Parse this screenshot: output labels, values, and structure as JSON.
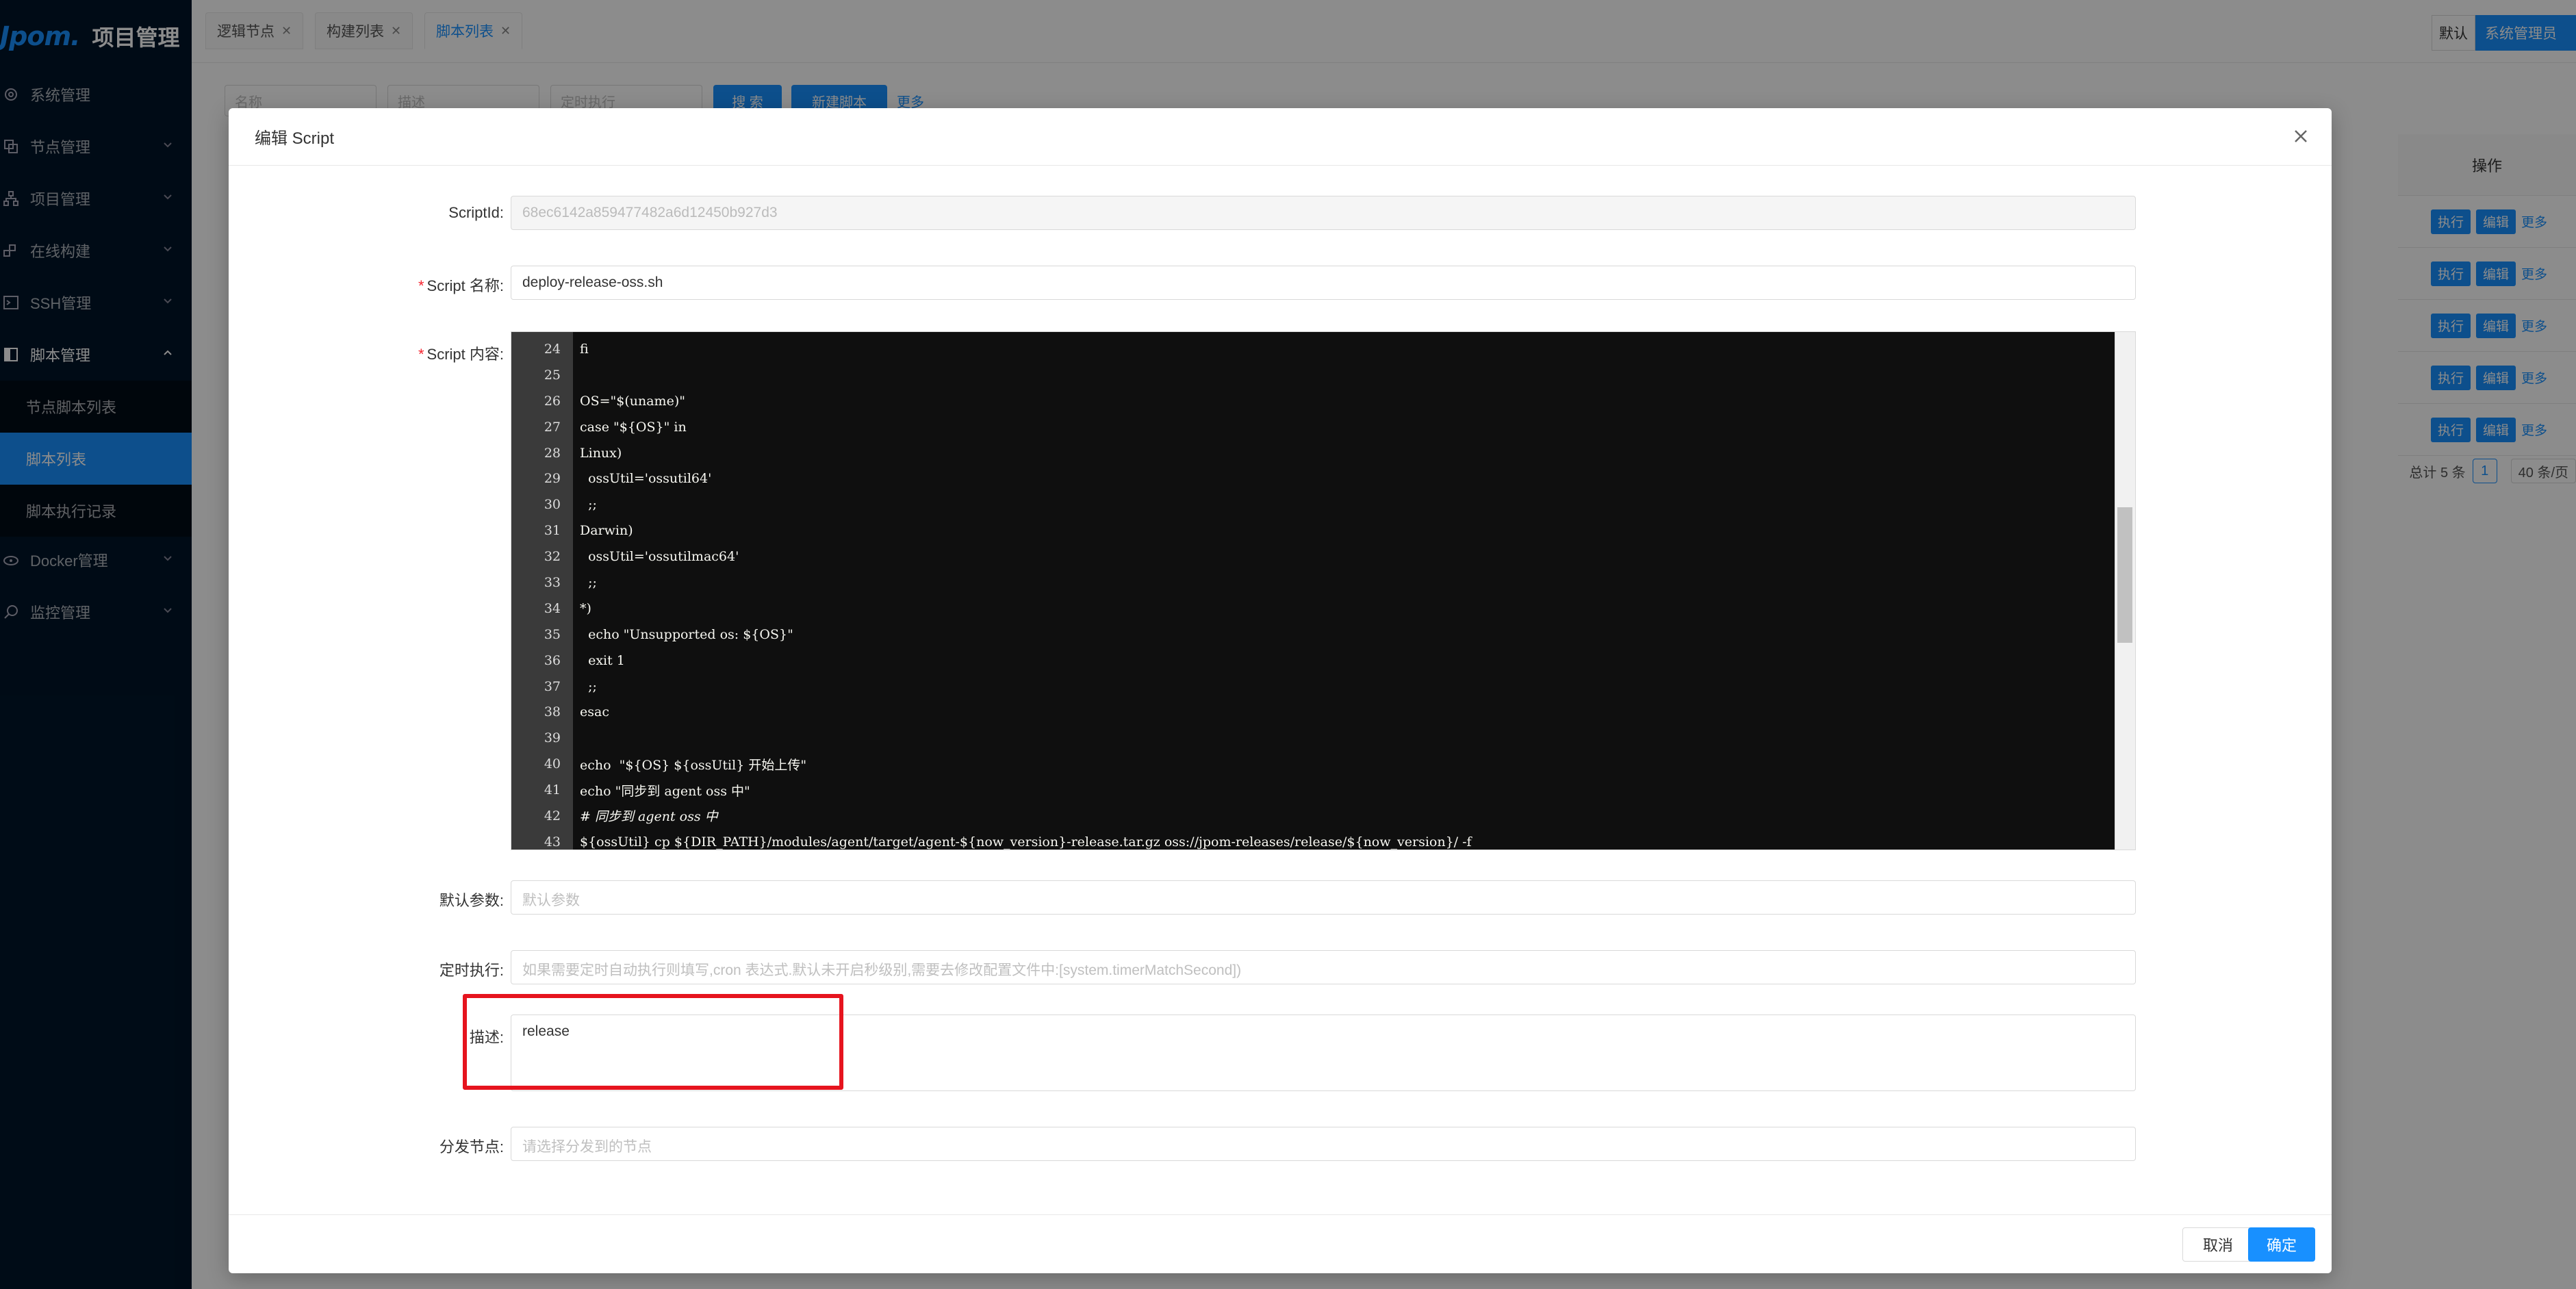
{
  "app": {
    "brand": "Jpom.",
    "title": "项目管理"
  },
  "sidebar": {
    "items": [
      {
        "label": "系统管理",
        "icon": "gear-icon"
      },
      {
        "label": "节点管理",
        "icon": "copy-icon"
      },
      {
        "label": "项目管理",
        "icon": "apartment-icon"
      },
      {
        "label": "在线构建",
        "icon": "build-icon"
      },
      {
        "label": "SSH管理",
        "icon": "terminal-icon"
      },
      {
        "label": "脚本管理",
        "icon": "script-icon"
      },
      {
        "label": "Docker管理",
        "icon": "docker-icon"
      },
      {
        "label": "监控管理",
        "icon": "monitor-icon"
      }
    ],
    "subitems": [
      {
        "label": "节点脚本列表"
      },
      {
        "label": "脚本列表"
      },
      {
        "label": "脚本执行记录"
      }
    ]
  },
  "tabs": [
    {
      "label": "逻辑节点"
    },
    {
      "label": "构建列表"
    },
    {
      "label": "脚本列表"
    }
  ],
  "user": {
    "workspace": "默认",
    "name": "系统管理员"
  },
  "search": {
    "name_placeholder": "名称",
    "desc_placeholder": "描述",
    "cron_placeholder": "定时执行",
    "search_label": "搜 索",
    "new_label": "新建脚本",
    "more_label": "更多"
  },
  "table": {
    "op_header": "操作",
    "run_label": "执行",
    "edit_label": "编辑",
    "more_label": "更多",
    "total": "总计 5 条",
    "page": "1",
    "page_size": "40 条/页"
  },
  "modal": {
    "title": "编辑 Script",
    "fields": {
      "script_id_label": "ScriptId",
      "script_id_value": "68ec6142a859477482a6d12450b927d3",
      "name_label": "Script 名称",
      "name_value": "deploy-release-oss.sh",
      "content_label": "Script 内容",
      "default_args_label": "默认参数",
      "default_args_placeholder": "默认参数",
      "cron_label": "定时执行",
      "cron_placeholder": "如果需要定时自动执行则填写,cron 表达式.默认未开启秒级别,需要去修改配置文件中:[system.timerMatchSecond])",
      "desc_label": "描述",
      "desc_value": "release",
      "dispatch_label": "分发节点",
      "dispatch_placeholder": "请选择分发到的节点"
    },
    "code": [
      {
        "ln": "24",
        "text": "fi"
      },
      {
        "ln": "25",
        "text": ""
      },
      {
        "ln": "26",
        "text": "OS=\"$(uname)\""
      },
      {
        "ln": "27",
        "text": "case \"${OS}\" in"
      },
      {
        "ln": "28",
        "text": "Linux)"
      },
      {
        "ln": "29",
        "text": "  ossUtil='ossutil64'"
      },
      {
        "ln": "30",
        "text": "  ;;"
      },
      {
        "ln": "31",
        "text": "Darwin)"
      },
      {
        "ln": "32",
        "text": "  ossUtil='ossutilmac64'"
      },
      {
        "ln": "33",
        "text": "  ;;"
      },
      {
        "ln": "34",
        "text": "*)"
      },
      {
        "ln": "35",
        "text": "  echo \"Unsupported os: ${OS}\""
      },
      {
        "ln": "36",
        "text": "  exit 1"
      },
      {
        "ln": "37",
        "text": "  ;;"
      },
      {
        "ln": "38",
        "text": "esac"
      },
      {
        "ln": "39",
        "text": ""
      },
      {
        "ln": "40",
        "text": "echo  \"${OS} ${ossUtil} 开始上传\""
      },
      {
        "ln": "41",
        "text": "echo \"同步到 agent oss 中\""
      },
      {
        "ln": "42",
        "text": "# 同步到 agent oss 中"
      },
      {
        "ln": "43",
        "text": "${ossUtil} cp ${DIR_PATH}/modules/agent/target/agent-${now_version}-release.tar.gz oss://jpom-releases/release/${now_version}/ -f"
      }
    ],
    "cancel_label": "取消",
    "ok_label": "确定"
  },
  "colors": {
    "primary": "#1890ff",
    "sidebar": "#001529",
    "highlight": "#e6141e"
  }
}
